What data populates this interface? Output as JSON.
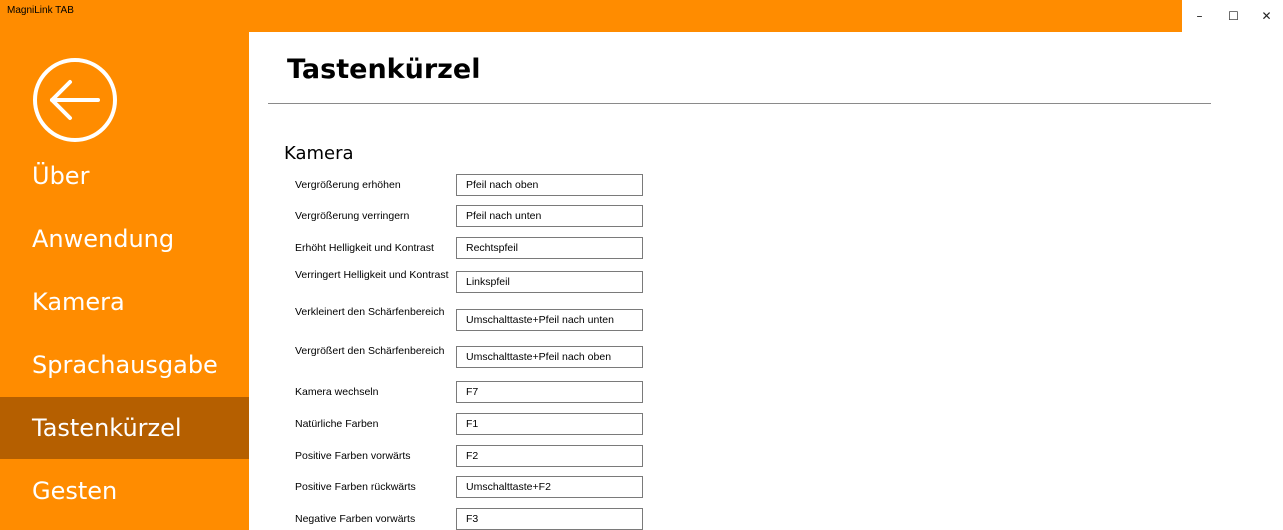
{
  "window": {
    "title": "MagniLink TAB",
    "controls": {
      "minimize": "–",
      "maximize": "☐",
      "close": "✕"
    }
  },
  "colors": {
    "accent": "#ff8c00",
    "selected": "#b55f00",
    "text_on_accent": "#ffffff"
  },
  "sidebar": {
    "items": [
      {
        "label": "Über"
      },
      {
        "label": "Anwendung"
      },
      {
        "label": "Kamera"
      },
      {
        "label": "Sprachausgabe"
      },
      {
        "label": "Tastenkürzel",
        "selected": true
      },
      {
        "label": "Gesten"
      }
    ]
  },
  "main": {
    "title": "Tastenkürzel",
    "section": "Kamera",
    "shortcuts": [
      {
        "label": "Vergrößerung erhöhen",
        "value": "Pfeil nach oben"
      },
      {
        "label": "Vergrößerung verringern",
        "value": "Pfeil nach unten"
      },
      {
        "label": "Erhöht Helligkeit und Kontrast",
        "value": "Rechtspfeil"
      },
      {
        "label": "Verringert Helligkeit und Kontrast",
        "value": "Linkspfeil"
      },
      {
        "label": "Verkleinert den Schärfenbereich",
        "value": "Umschalttaste+Pfeil nach unten"
      },
      {
        "label": "Vergrößert den Schärfenbereich",
        "value": "Umschalttaste+Pfeil nach oben"
      },
      {
        "label": "Kamera wechseln",
        "value": "F7"
      },
      {
        "label": "Natürliche Farben",
        "value": "F1"
      },
      {
        "label": "Positive Farben vorwärts",
        "value": "F2"
      },
      {
        "label": "Positive Farben rückwärts",
        "value": "Umschalttaste+F2"
      },
      {
        "label": "Negative Farben vorwärts",
        "value": "F3"
      }
    ]
  }
}
